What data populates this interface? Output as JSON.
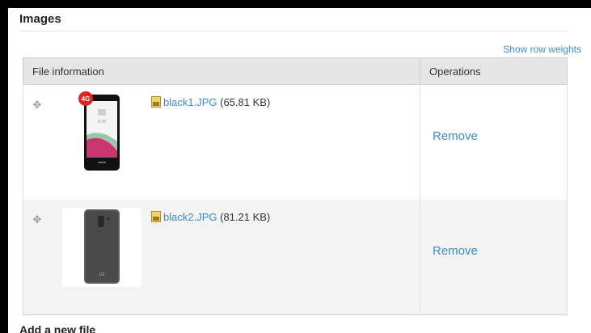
{
  "section": {
    "title": "Images",
    "show_row_weights": "Show row weights"
  },
  "table": {
    "headers": {
      "file_information": "File information",
      "operations": "Operations"
    },
    "rows": [
      {
        "badge": "4G",
        "file_name": "black1.JPG",
        "file_size": "(65.81 KB)",
        "remove_label": "Remove",
        "thumb_icon": "phone-front-image"
      },
      {
        "file_name": "black2.JPG",
        "file_size": "(81.21 KB)",
        "remove_label": "Remove",
        "thumb_icon": "phone-back-image"
      }
    ]
  },
  "add_new_file": "Add a new file",
  "colors": {
    "link": "#3b8dc7",
    "header_bg": "#e6e6e6",
    "row_alt_bg": "#f3f3f3"
  }
}
